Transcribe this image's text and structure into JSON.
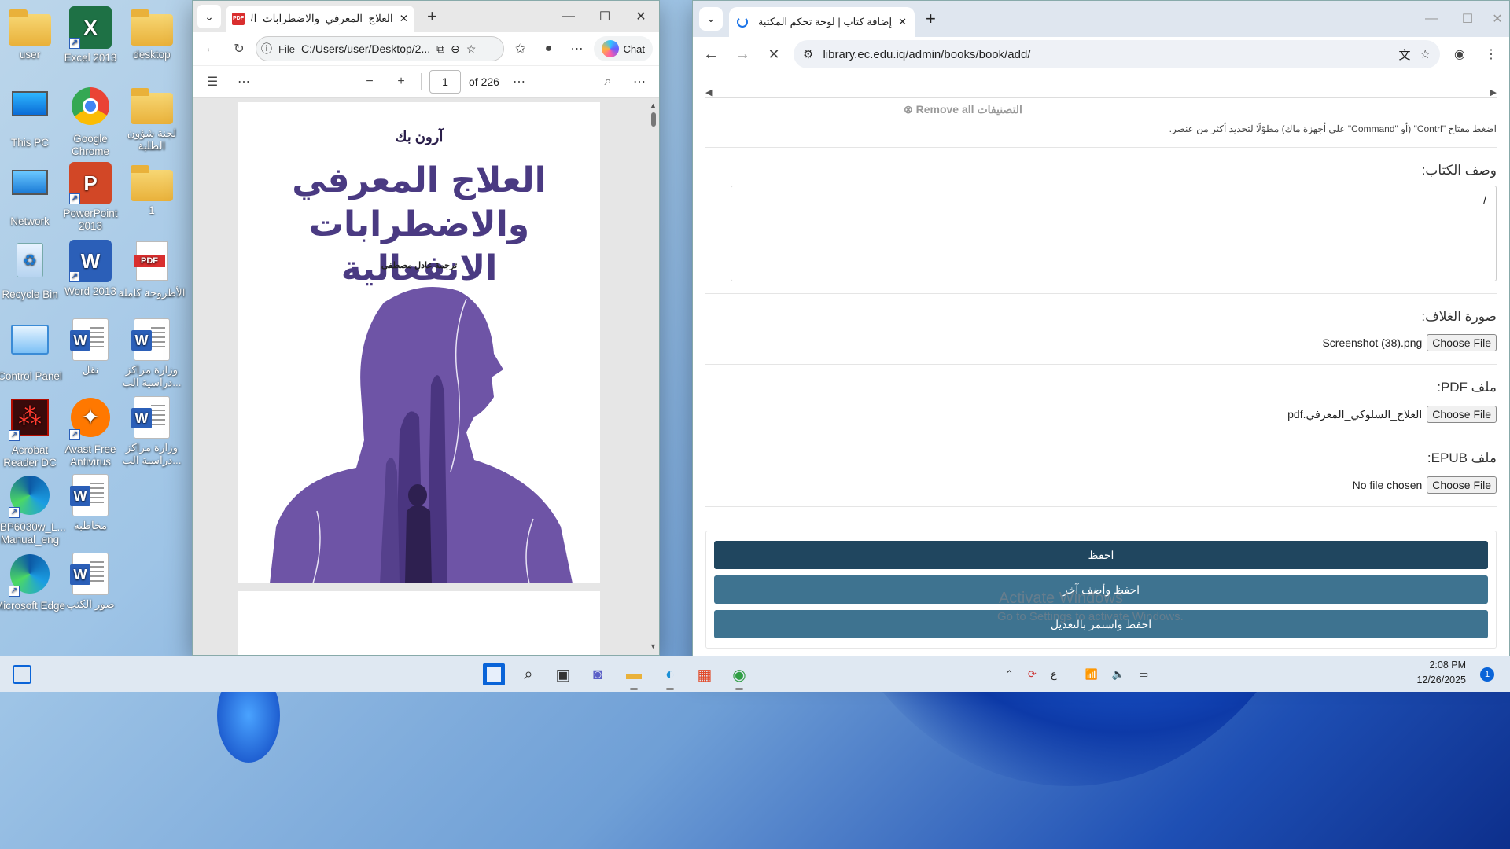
{
  "desktop": {
    "icons": [
      {
        "label": "user",
        "kind": "folder-user"
      },
      {
        "label": "Excel 2013",
        "kind": "excel"
      },
      {
        "label": "desktop",
        "kind": "folder"
      },
      {
        "label": "This PC",
        "kind": "monitor"
      },
      {
        "label": "Google Chrome",
        "kind": "chrome"
      },
      {
        "label": "لجنة شؤون الطلبة",
        "kind": "folder"
      },
      {
        "label": "Network",
        "kind": "network"
      },
      {
        "label": "PowerPoint 2013",
        "kind": "powerpoint"
      },
      {
        "label": "1",
        "kind": "folder"
      },
      {
        "label": "Recycle Bin",
        "kind": "recycle"
      },
      {
        "label": "Word 2013",
        "kind": "word"
      },
      {
        "label": "الأطروحة كاملة",
        "kind": "pdf"
      },
      {
        "label": "Control Panel",
        "kind": "control-panel"
      },
      {
        "label": "نقل",
        "kind": "doc"
      },
      {
        "label": "وزارة مراكز دراسية الب...",
        "kind": "doc"
      },
      {
        "label": "Acrobat Reader DC",
        "kind": "acrobat"
      },
      {
        "label": "Avast Free Antivirus",
        "kind": "avast"
      },
      {
        "label": "وزارة مراكز دراسية الب...",
        "kind": "doc"
      },
      {
        "label": "LBP6030w_L... Manual_eng",
        "kind": "edge"
      },
      {
        "label": "مخاطبة",
        "kind": "doc"
      },
      {
        "label": "Microsoft Edge",
        "kind": "edge"
      },
      {
        "label": "صور الكتب",
        "kind": "doc"
      }
    ]
  },
  "edge": {
    "tab_title": "العلاج_المعرفي_والاضطرابات_الانفعالية",
    "pdf_badge": "PDF",
    "address_scheme": "File",
    "address_url": "C:/Users/user/Desktop/2...",
    "chat_label": "Chat",
    "page_current": "1",
    "page_total": "of 226",
    "cover": {
      "author": "آرون بك",
      "title_line1": "العلاج المعرفي",
      "title_line2": "والاضطرابات الانفعالية",
      "translator": "ترجمة عادل مصطفى"
    }
  },
  "chrome": {
    "tab_title": "إضافة كتاب | لوحة تحكم المكتبة",
    "url": "library.ec.edu.iq/admin/books/book/add/",
    "remove_all": "Remove all التصنيفات",
    "help_text": "اضغط مفتاح \"Contrl\" (أو \"Command\" على أجهزة ماك) مطوّلًا لتحديد أكثر من عنصر.",
    "description_label": "وصف الكتاب:",
    "description_value": "/",
    "cover_label": "صورة الغلاف:",
    "cover_file": "Screenshot (38).png",
    "pdf_label": "ملف PDF:",
    "pdf_file": "العلاج_السلوكي_المعرفي.pdf",
    "epub_label": "ملف EPUB:",
    "epub_file": "No file chosen",
    "choose_file": "Choose File",
    "save": "احفظ",
    "save_add_another": "احفظ وأضف آخر",
    "save_continue": "احفظ واستمر بالتعديل"
  },
  "watermark": {
    "title": "Activate Windows",
    "subtitle": "Go to Settings to activate Windows."
  },
  "taskbar": {
    "input_lang": "ع",
    "time": "2:08 PM",
    "date": "12/26/2025",
    "notifications": "1"
  }
}
